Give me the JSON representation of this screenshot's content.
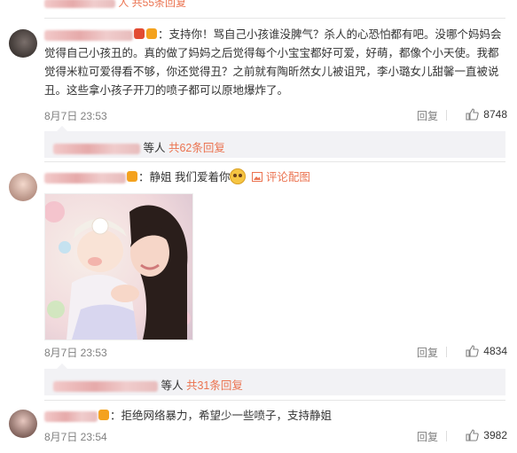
{
  "top_fragment": {
    "suffix": "人 共55条回复"
  },
  "comments": [
    {
      "avatar_icon": "user-avatar-icon",
      "text": "：支持你！骂自己小孩谁没脾气？杀人的心恐怕都有吧。没哪个妈妈会觉得自己小孩丑的。真的做了妈妈之后觉得每个小宝宝都好可爱，好萌，都像个小天使。我都觉得米粒可爱得看不够，你还觉得丑？之前就有陶昕然女儿被诅咒，李小璐女儿甜馨一直被说丑。这些拿小孩子开刀的喷子都可以原地爆炸了。",
      "time": "8月7日 23:53",
      "reply": "回复",
      "likes": "8748",
      "subreplies": {
        "mid": "等人",
        "more": "共62条回复"
      }
    },
    {
      "avatar_icon": "user-avatar-icon",
      "text": "：静姐 我们爱着你",
      "pic_link": "评论配图",
      "time": "8月7日 23:53",
      "reply": "回复",
      "likes": "4834",
      "subreplies": {
        "mid": "等人",
        "more": "共31条回复"
      }
    },
    {
      "avatar_icon": "user-avatar-icon",
      "text": "：拒绝网络暴力，希望少一些喷子，支持静姐",
      "time": "8月7日 23:54",
      "reply": "回复",
      "likes": "3982"
    }
  ],
  "colors": {
    "accent": "#eb7350",
    "meta_gray": "#808080",
    "sub_bg": "#f2f2f5"
  }
}
